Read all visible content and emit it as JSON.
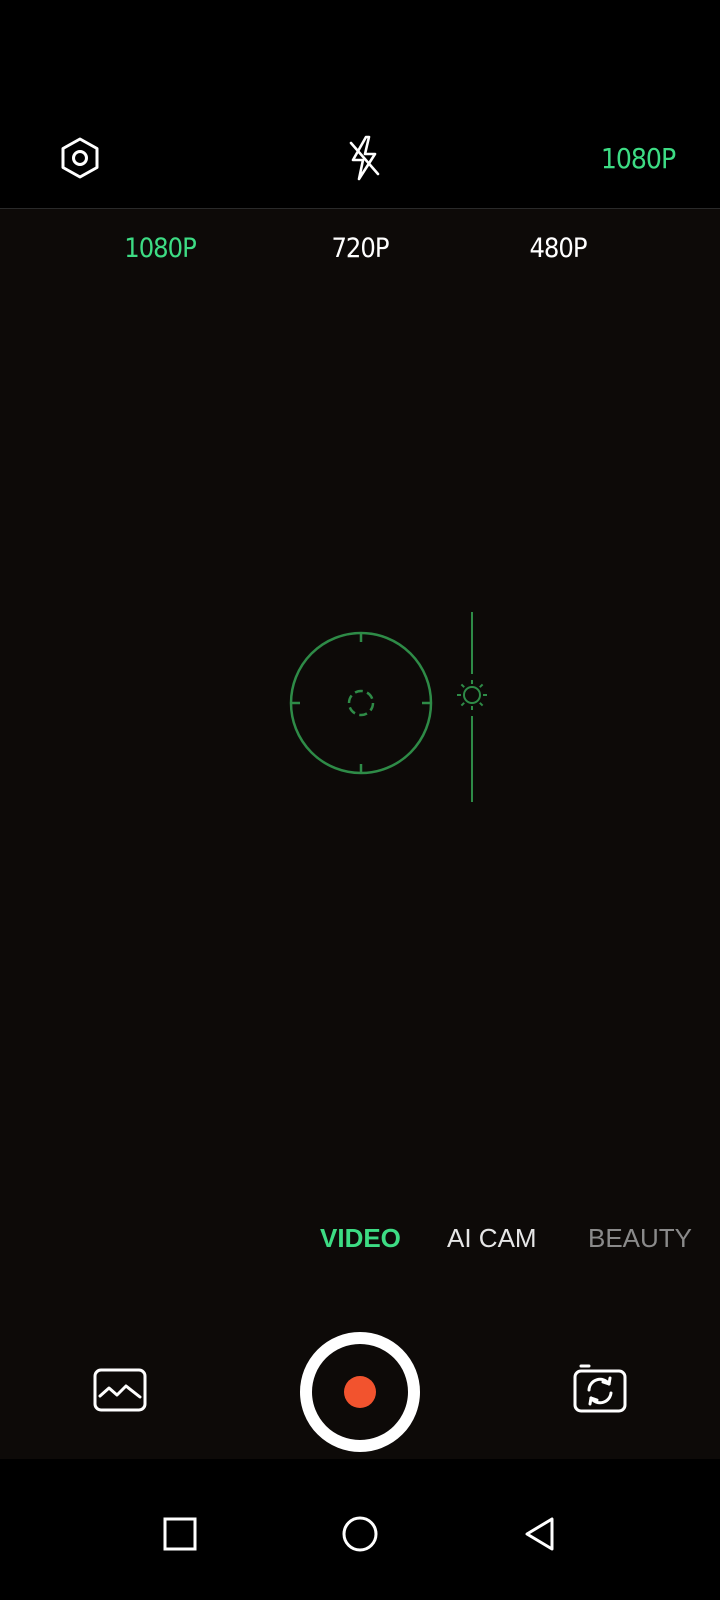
{
  "toolbar": {
    "settings_icon": "hexagon-settings-icon",
    "flash_icon": "flash-off-icon",
    "current_resolution": "1080P"
  },
  "resolution_options": [
    {
      "label": "1080P",
      "active": true
    },
    {
      "label": "720P",
      "active": false
    },
    {
      "label": "480P",
      "active": false
    }
  ],
  "modes": [
    {
      "label": "VIDEO",
      "active": true
    },
    {
      "label": "AI CAM",
      "active": false
    },
    {
      "label": "BEAUTY",
      "active": false
    }
  ],
  "colors": {
    "accent": "#3ddc84",
    "focus_ring": "#2e8b47",
    "record": "#f2532e"
  },
  "bottom_controls": {
    "gallery_icon": "gallery-icon",
    "record_icon": "record-icon",
    "switch_camera_icon": "switch-camera-icon"
  },
  "nav": {
    "back_icon": "square-recents-icon",
    "home_icon": "circle-home-icon",
    "recents_icon": "triangle-back-icon"
  }
}
